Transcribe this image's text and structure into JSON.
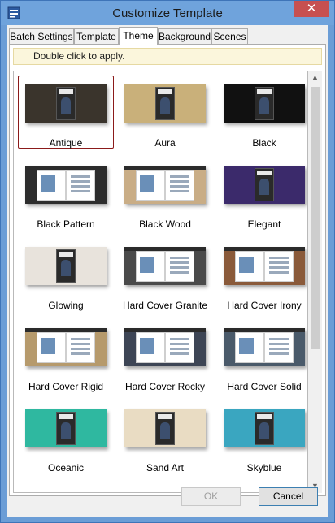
{
  "window": {
    "title": "Customize Template",
    "close_label": "✕"
  },
  "tabs": [
    {
      "label": "Batch Settings"
    },
    {
      "label": "Template"
    },
    {
      "label": "Theme"
    },
    {
      "label": "Background"
    },
    {
      "label": "Scenes"
    }
  ],
  "hint": "Double click to apply.",
  "themes": [
    {
      "label": "Antique",
      "bg": "#3a342c",
      "style": "mag"
    },
    {
      "label": "Aura",
      "bg": "#c9b07a",
      "style": "mag"
    },
    {
      "label": "Black",
      "bg": "#111111",
      "style": "mag"
    },
    {
      "label": "Black Pattern",
      "bg": "#2d2d2d",
      "style": "book"
    },
    {
      "label": "Black Wood",
      "bg": "#c9ad86",
      "style": "book"
    },
    {
      "label": "Elegant",
      "bg": "#3b2a6b",
      "style": "mag"
    },
    {
      "label": "Glowing",
      "bg": "#e8e3dc",
      "style": "mag"
    },
    {
      "label": "Hard Cover Granite",
      "bg": "#4a4a4a",
      "style": "book"
    },
    {
      "label": "Hard Cover Irony",
      "bg": "#8a5a3a",
      "style": "book"
    },
    {
      "label": "Hard Cover Rigid",
      "bg": "#b69a6c",
      "style": "book"
    },
    {
      "label": "Hard Cover Rocky",
      "bg": "#3d4555",
      "style": "book"
    },
    {
      "label": "Hard Cover Solid",
      "bg": "#4a5a6a",
      "style": "book"
    },
    {
      "label": "Oceanic",
      "bg": "#2fb8a0",
      "style": "mag"
    },
    {
      "label": "Sand Art",
      "bg": "#e9dcc3",
      "style": "mag"
    },
    {
      "label": "Skyblue",
      "bg": "#3aa6c0",
      "style": "mag"
    }
  ],
  "selected_theme": "Antique",
  "buttons": {
    "ok": "OK",
    "cancel": "Cancel"
  },
  "colors": {
    "selection_border": "#8b1a1a",
    "title_bar": "#6fa3dc",
    "close_button": "#c75050"
  }
}
